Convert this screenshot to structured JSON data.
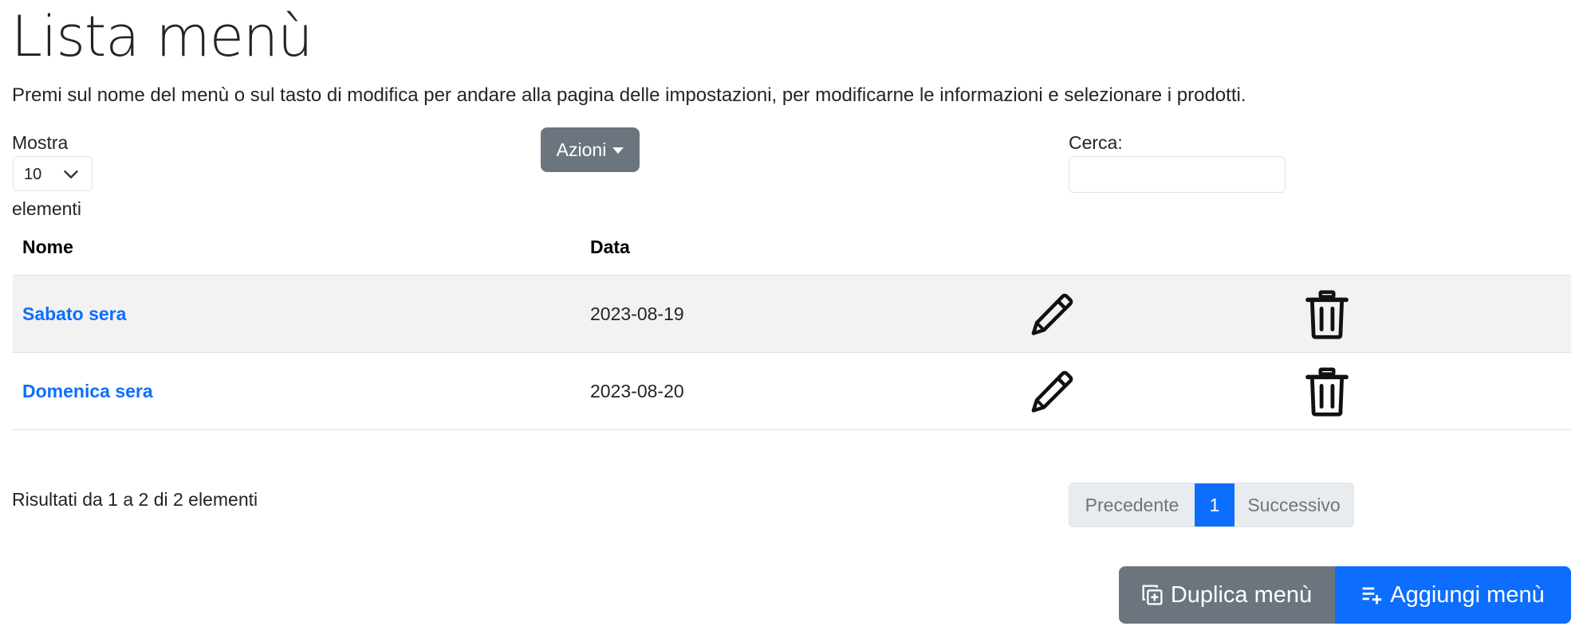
{
  "header": {
    "title": "Lista menù",
    "subtitle": "Premi sul nome del menù o sul tasto di modifica per andare alla pagina delle impostazioni, per modificarne le informazioni e selezionare i prodotti."
  },
  "controls": {
    "show_label": "Mostra",
    "page_size": "10",
    "elements_label": "elementi",
    "actions_label": "Azioni",
    "search_label": "Cerca:",
    "search_value": ""
  },
  "table": {
    "headers": [
      "Nome",
      "Data"
    ],
    "rows": [
      {
        "name": "Sabato sera",
        "date": "2023-08-19"
      },
      {
        "name": "Domenica sera",
        "date": "2023-08-20"
      }
    ]
  },
  "footer": {
    "results": "Risultati da 1 a 2 di 2 elementi",
    "prev": "Precedente",
    "page": "1",
    "next": "Successivo",
    "duplicate": "Duplica menù",
    "add": "Aggiungi menù"
  },
  "colors": {
    "primary": "#0d6efd",
    "secondary": "#6c757d",
    "stripe": "#f2f2f2"
  },
  "icons": {
    "row_actions": [
      "pencil-icon",
      "trash-icon"
    ],
    "duplicate": "copy-plus-icon",
    "add": "playlist-add-icon",
    "select": "chevron-down-icon",
    "actions": "caret-down-icon"
  }
}
